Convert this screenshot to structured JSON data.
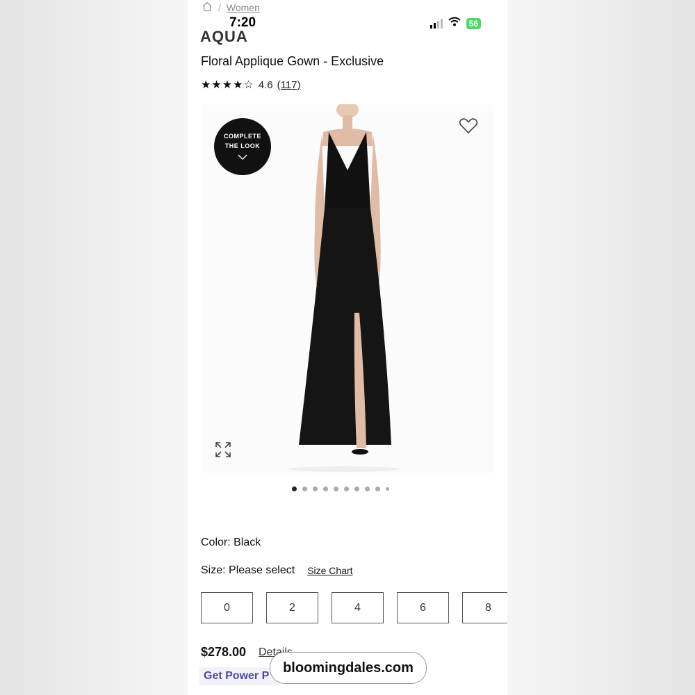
{
  "breadcrumb": {
    "current": "Women"
  },
  "status_bar": {
    "time": "7:20",
    "battery": "56"
  },
  "product": {
    "brand": "AQUA",
    "title": "Floral Applique Gown - Exclusive",
    "rating_value": "4.6",
    "rating_count": "(117)",
    "stars": "★★★★☆"
  },
  "gallery": {
    "complete_look_line1": "COMPLETE",
    "complete_look_line2": "THE LOOK",
    "dots_total": 10,
    "active_index": 0
  },
  "options": {
    "color_label": "Color: Black",
    "size_label": "Size: Please select",
    "size_chart": "Size Chart",
    "sizes": [
      "0",
      "2",
      "4",
      "6",
      "8"
    ]
  },
  "pricing": {
    "price": "$278.00",
    "details": "Details",
    "power": "Get Power P"
  },
  "watermark": "bloomingdales.com",
  "colors": {
    "accent": "#4b48a8",
    "battery": "#4cd964"
  }
}
